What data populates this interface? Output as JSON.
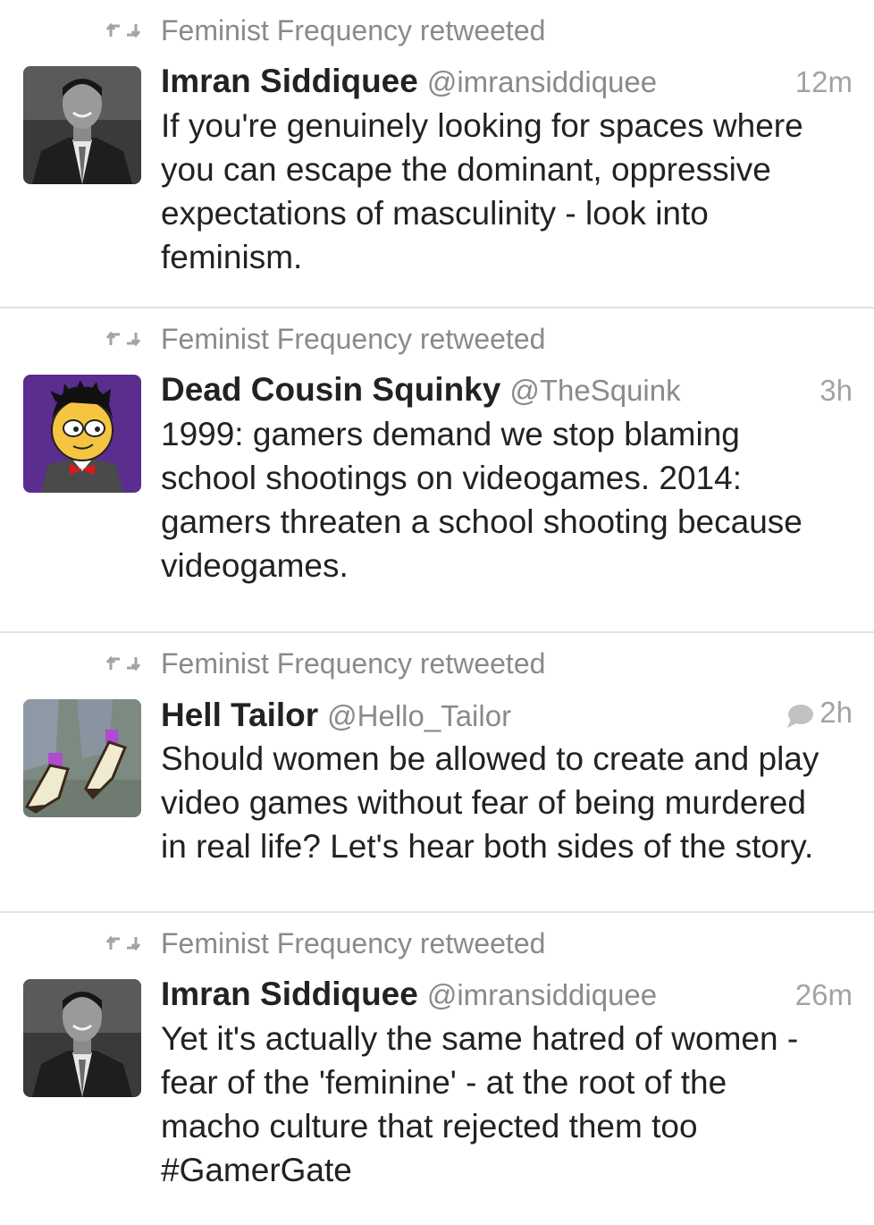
{
  "colors": {
    "text": "#222222",
    "muted": "#8a8a8a",
    "timestamp": "#a3a3a3",
    "divider": "#e3e3e3",
    "background": "#ffffff"
  },
  "tweets": [
    {
      "retweet_label": "Feminist Frequency retweeted",
      "name": "Imran Siddiquee",
      "handle": "@imransiddiquee",
      "time": "12m",
      "text": "If you're genuinely looking for spaces where\nyou can escape the dominant, oppressive\nexpectations of masculinity - look into\nfeminism.",
      "avatar": "photo-man-in-suit",
      "has_reply_icon": false
    },
    {
      "retweet_label": "Feminist Frequency retweeted",
      "name": "Dead Cousin Squinky",
      "handle": "@TheSquink",
      "time": "3h",
      "text": "1999: gamers demand we stop blaming\nschool shootings on videogames. 2014:\ngamers threaten a school shooting because\nvideogames.",
      "avatar": "cartoon-character-purple",
      "has_reply_icon": false
    },
    {
      "retweet_label": "Feminist Frequency retweeted",
      "name": "Hell Tailor",
      "handle": "@Hello_Tailor",
      "time": "2h",
      "text": "Should women be allowed to create and play\nvideo games without fear of being murdered\nin real life? Let's hear both sides of the story.",
      "avatar": "photo-shoes",
      "has_reply_icon": true
    },
    {
      "retweet_label": "Feminist Frequency retweeted",
      "name": "Imran Siddiquee",
      "handle": "@imransiddiquee",
      "time": "26m",
      "text": "Yet it's actually the same hatred of women -\nfear of the 'feminine' - at the root of the\nmacho culture that rejected them too\n#GamerGate",
      "avatar": "photo-man-in-suit",
      "has_reply_icon": false
    }
  ]
}
